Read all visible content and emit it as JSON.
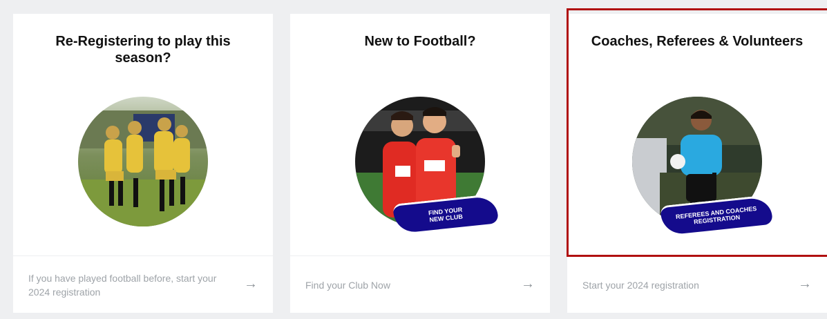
{
  "cards": [
    {
      "title": "Re-Registering to play this season?",
      "image": "girls-football-team-celebrating",
      "footer_text": "If you have played football before, start your 2024 registration",
      "arrow_icon": "arrow-right-icon"
    },
    {
      "title": "New to Football?",
      "image": "two-players-red-kit",
      "banner_line1": "FIND YOUR",
      "banner_line2": "NEW CLUB",
      "footer_text": "Find your Club Now",
      "arrow_icon": "arrow-right-icon"
    },
    {
      "title": "Coaches, Referees & Volunteers",
      "image": "referee-with-ball",
      "banner_line1": "REFEREES AND COACHES",
      "banner_line2": "REGISTRATION",
      "footer_text": "Start your 2024 registration",
      "arrow_icon": "arrow-right-icon"
    }
  ],
  "colors": {
    "page_bg": "#eeeff1",
    "card_bg": "#ffffff",
    "banner": "#140b8c",
    "selection": "#b00f0f"
  }
}
